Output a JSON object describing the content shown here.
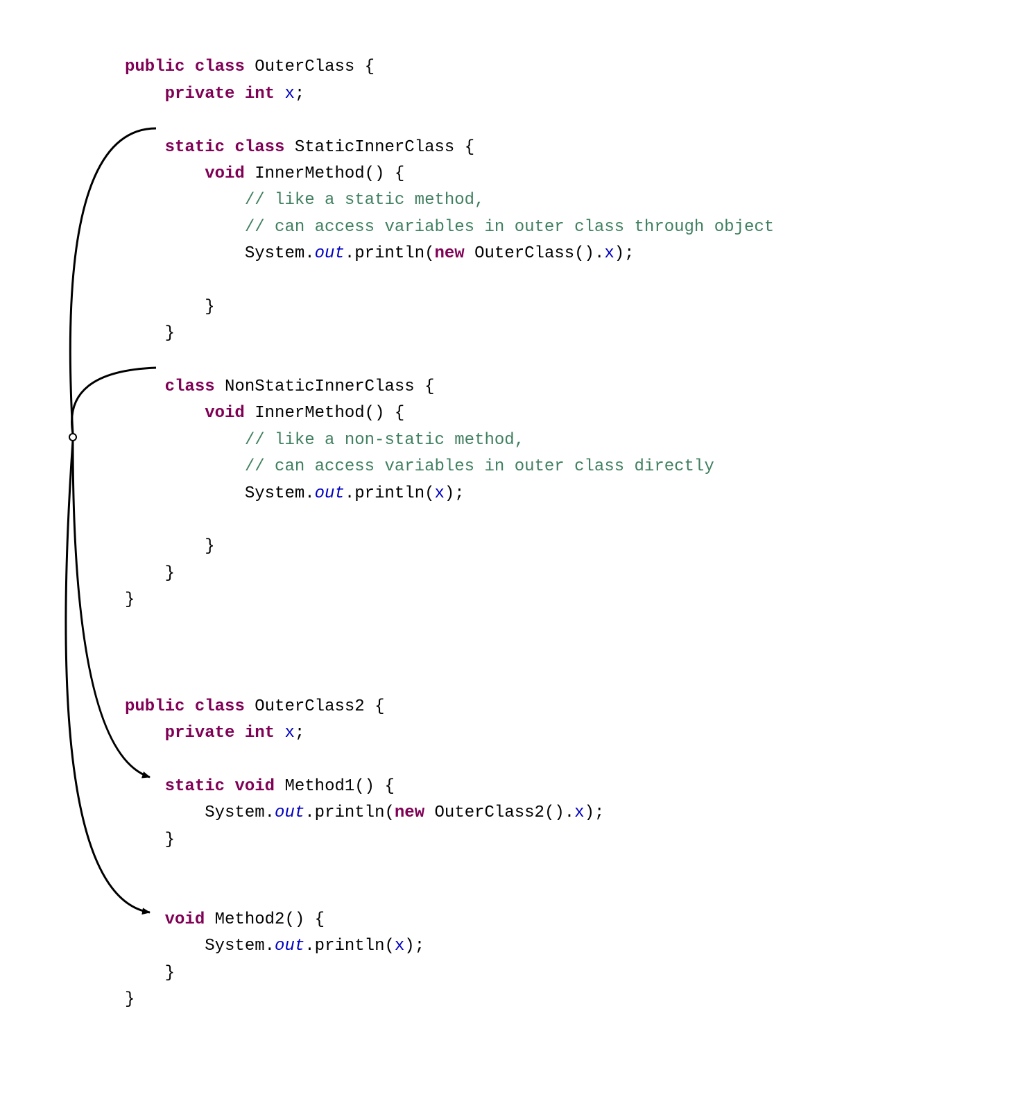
{
  "code": {
    "block1": {
      "l1_public": "public",
      "l1_class": "class",
      "l1_name": "OuterClass {",
      "l2_private": "private",
      "l2_int": "int",
      "l2_x": "x",
      "l2_semi": ";",
      "l4_static": "static",
      "l4_class": "class",
      "l4_name": "StaticInnerClass {",
      "l5_void": "void",
      "l5_name": "InnerMethod() {",
      "l6_comment": "// like a static method,",
      "l7_comment": "// can access variables in outer class through object",
      "l8_sys": "System.",
      "l8_out": "out",
      "l8_print": ".println(",
      "l8_new": "new",
      "l8_outer": " OuterClass().",
      "l8_x": "x",
      "l8_end": ");",
      "l10_close": "}",
      "l11_close": "}",
      "l13_class": "class",
      "l13_name": "NonStaticInnerClass {",
      "l14_void": "void",
      "l14_name": "InnerMethod() {",
      "l15_comment": "// like a non-static method,",
      "l16_comment": "// can access variables in outer class directly",
      "l17_sys": "System.",
      "l17_out": "out",
      "l17_print": ".println(",
      "l17_x": "x",
      "l17_end": ");",
      "l19_close": "}",
      "l20_close": "}",
      "l21_close": "}"
    },
    "block2": {
      "l1_public": "public",
      "l1_class": "class",
      "l1_name": "OuterClass2 {",
      "l2_private": "private",
      "l2_int": "int",
      "l2_x": "x",
      "l2_semi": ";",
      "l4_static": "static",
      "l4_void": "void",
      "l4_name": "Method1() {",
      "l5_sys": "System.",
      "l5_out": "out",
      "l5_print": ".println(",
      "l5_new": "new",
      "l5_outer": " OuterClass2().",
      "l5_x": "x",
      "l5_end": ");",
      "l6_close": "}",
      "l9_void": "void",
      "l9_name": "Method2() {",
      "l10_sys": "System.",
      "l10_out": "out",
      "l10_print": ".println(",
      "l10_x": "x",
      "l10_end": ");",
      "l11_close": "}",
      "l12_close": "}"
    }
  },
  "arrows": [
    {
      "from": "static-inner-class",
      "to": "method1"
    },
    {
      "from": "nonstatic-inner-class",
      "to": "method2"
    }
  ]
}
